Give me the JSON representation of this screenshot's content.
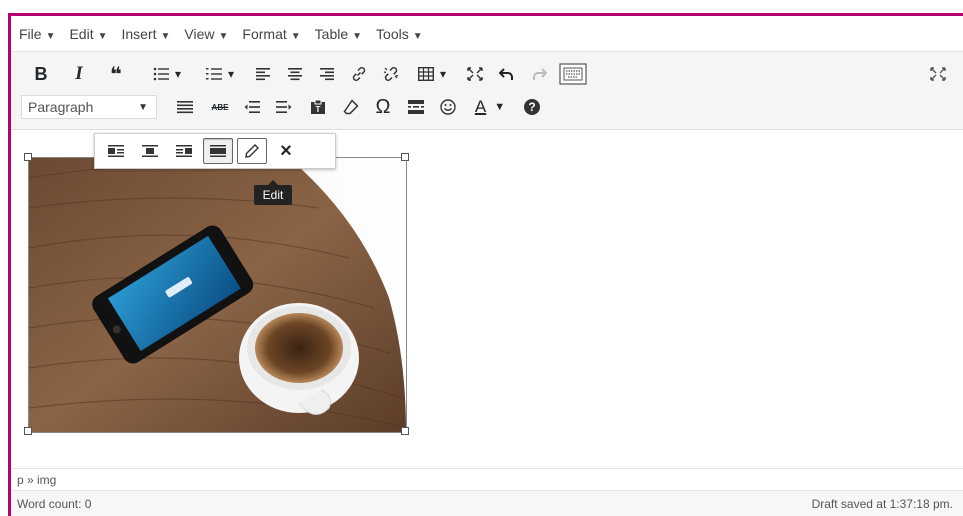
{
  "menubar": {
    "items": [
      "File",
      "Edit",
      "Insert",
      "View",
      "Format",
      "Table",
      "Tools"
    ],
    "caret": "▼"
  },
  "toolbar1": {
    "bold": "B",
    "italic": "I",
    "blockquote": "❝",
    "caret": "▾",
    "icons": [
      "bold-icon",
      "italic-icon",
      "blockquote-icon",
      "bulleted-list-icon",
      "numbered-list-icon",
      "align-left-icon",
      "align-center-icon",
      "align-right-icon",
      "insert-link-icon",
      "remove-link-icon",
      "table-icon",
      "fullscreen-icon",
      "undo-icon",
      "redo-icon",
      "keyboard-icon",
      "distraction-free-icon"
    ]
  },
  "toolbar2": {
    "format_select": "Paragraph",
    "caret": "▼",
    "strikethrough_label": "ABE",
    "omega": "Ω",
    "text_color": "A",
    "help": "?",
    "icons": [
      "horizontal-line-icon",
      "strikethrough-icon",
      "indent-icon",
      "outdent-icon",
      "paste-text-icon",
      "clear-formatting-icon",
      "special-character-icon",
      "read-more-icon",
      "emoji-icon",
      "text-color-icon",
      "help-icon"
    ]
  },
  "image_toolbar": {
    "close": "×",
    "tooltip": "Edit",
    "icons": [
      "image-align-left-icon",
      "image-align-center-icon",
      "image-align-right-icon",
      "image-no-align-icon",
      "image-edit-icon",
      "image-remove-icon"
    ]
  },
  "image": {
    "description": "phone-and-coffee-on-wood"
  },
  "statusbar": {
    "path": "p » img"
  },
  "footer": {
    "word_count": "Word count: 0",
    "draft_saved": "Draft saved at 1:37:18 pm."
  },
  "colors": {
    "frame": "#b5006d",
    "toolbar_bg": "#f5f5f5",
    "tooltip_bg": "#222222"
  }
}
